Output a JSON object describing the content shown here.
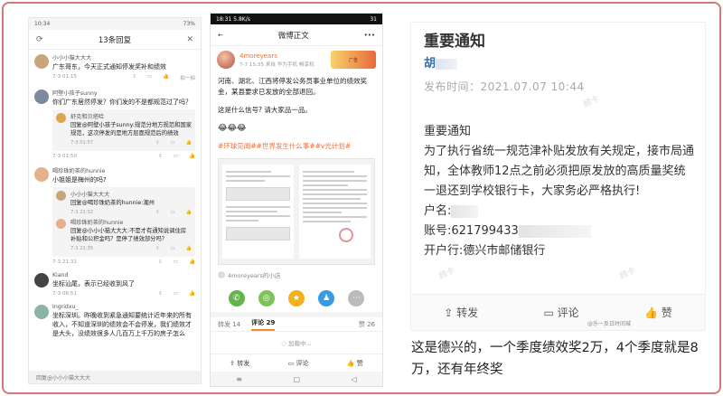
{
  "panel1": {
    "status_time": "10:34",
    "status_battery": "73%",
    "title": "13条回复",
    "comments": [
      {
        "name": "小小小猫大大大",
        "text": "广东哥东，今天正式通知停发奖补和绩效",
        "time": "7-3 01:15",
        "actions": [
          "",
          "",
          "",
          "拍一拍"
        ],
        "avatar_color": "#c9a57b"
      },
      {
        "name": "阿壁小孩子sunny",
        "text": "你们广东居然停发？你们发的不是都规范过了吗？",
        "time": "7-3 01:50",
        "actions": [
          "",
          "",
          ""
        ],
        "avatar_color": "#7b8a9d",
        "replies": [
          {
            "name": "舒克和贝塔哈",
            "text": "回复@阿壁小孩子sunny:规范分地方规范和国家规范，这次停发的是地方层面规范后的绩效",
            "time": "7-3 01:57",
            "avatar_color": "#d9a54f"
          }
        ]
      },
      {
        "name": "喝珍珠奶茶的hunnie",
        "text": "小姐姐是梅州的吗?",
        "time": "7-3 21:31",
        "actions": [
          "",
          "",
          ""
        ],
        "avatar_color": "#e4b08e",
        "replies": [
          {
            "name": "小小小猫大大大",
            "text": "回复@喝珍珠奶茶的hunnie:潮州",
            "time": "7-3 21:32",
            "avatar_color": "#c9a57b"
          },
          {
            "name": "喝珍珠奶茶的hunnie",
            "text": "回复@小小小猫大大大:不是才有通知说调住房补贴和公积金吗？是停了绩效部分吗？",
            "time": "7-3 21:35",
            "avatar_color": "#e4b08e"
          }
        ]
      },
      {
        "name": "Kiand",
        "text": "坐标汕尾，表示已经收到风了",
        "time": "7-3 06:51",
        "actions": [
          "",
          "",
          "",
          ""
        ],
        "avatar_color": "#444"
      },
      {
        "name": "Ingridxu_",
        "text": "坐标深圳。昨晚收到紧急通知要统计近年来的所有收入，不知道深圳的绩效会不会停发，我们绩效才是大头，没绩效很多人几百万上千万的房子怎么",
        "time": "",
        "actions": [],
        "avatar_color": "#8cb3a8"
      }
    ],
    "reply_placeholder": "回复@小小小猫大大大"
  },
  "panel2": {
    "status_time": "18:31",
    "status_speed": "5.8K/s",
    "status_battery": "31",
    "title": "微博正文",
    "username": "4moreyears",
    "post_meta": "7-7 15:35  来自 华为手机 畅享机",
    "ad_text": "广告",
    "paragraphs": [
      "河南、湖北、江西将停发公务员事业单位的绩效奖金，某县要求已发放的全部退回。",
      "这是什么信号? 请大家品一品。"
    ],
    "emojis": "😂😂😂",
    "tags": "#环球见闻##世界发生什么事##v光计划#",
    "source": "4moreyears的小店",
    "tabs": {
      "repost": "转发 14",
      "comment": "评论 29",
      "like": "赞 26"
    },
    "loading": "加载中...",
    "bottom_actions": [
      "转发",
      "评论",
      "赞"
    ],
    "nav": [
      "≡",
      "▢",
      "◁"
    ]
  },
  "panel3": {
    "title": "重要通知",
    "publisher": "胡",
    "time": "发布时间：2021.07.07 10:44",
    "body_lines": [
      "重要通知",
      "为了执行省统一规范津补贴发放有关规定，接市局通知，全体教师12点之前必须把原发放的高质量奖统一退还到学校银行卡，大家务必严格执行!",
      "户名:",
      "账号:621799433",
      "开户行:德兴市邮储银行"
    ],
    "actions": [
      "转发",
      "评论",
      "赞"
    ],
    "watermark_tag": "@乐一反日时间城",
    "watermarks": [
      "顾卡",
      "顾卡",
      "顾卡"
    ]
  },
  "caption": "这是德兴的，一个季度绩效奖2万，4个季度就是8万，还有年终奖"
}
